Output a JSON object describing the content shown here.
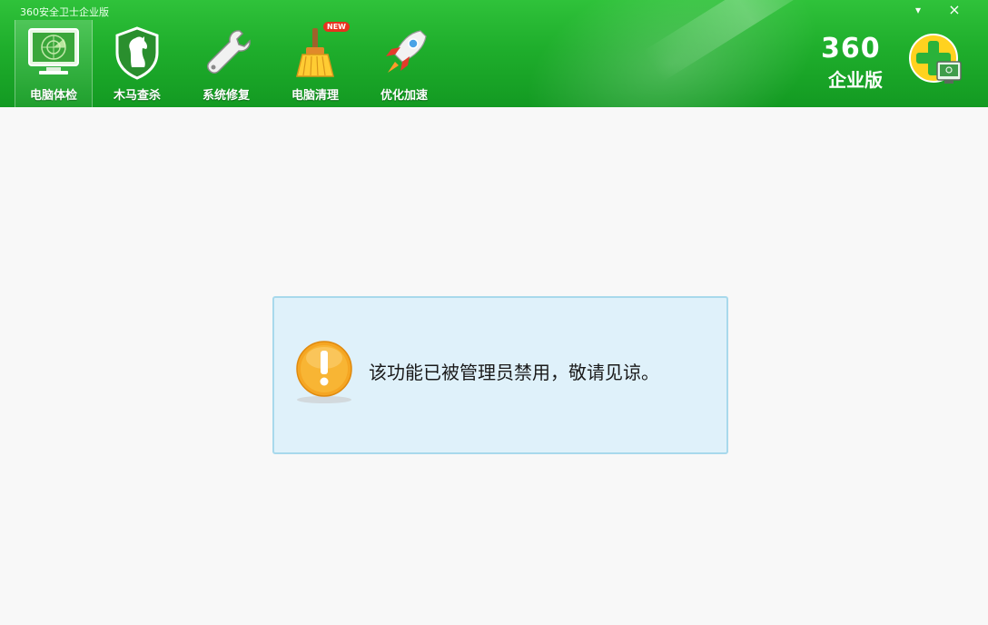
{
  "window": {
    "title": "360安全卫士企业版",
    "minimize_label": "▾",
    "close_label": "×"
  },
  "nav": {
    "items": [
      {
        "label": "电脑体检",
        "icon": "monitor-radar-icon",
        "active": true
      },
      {
        "label": "木马查杀",
        "icon": "horse-shield-icon",
        "active": false
      },
      {
        "label": "系统修复",
        "icon": "wrench-icon",
        "active": false
      },
      {
        "label": "电脑清理",
        "icon": "broom-icon",
        "active": false,
        "badge": "NEW"
      },
      {
        "label": "优化加速",
        "icon": "rocket-icon",
        "active": false
      }
    ]
  },
  "brand": {
    "number": "360",
    "edition": "企业版",
    "logo_icon": "360-plus-monitor-icon"
  },
  "notice": {
    "icon": "warning-exclamation-icon",
    "message": "该功能已被管理员禁用，敬请见谅。"
  },
  "colors": {
    "header_green": "#1fae2c",
    "notice_bg": "#dff1fa",
    "notice_border": "#a8d9ec",
    "warning_orange": "#f5a623"
  }
}
